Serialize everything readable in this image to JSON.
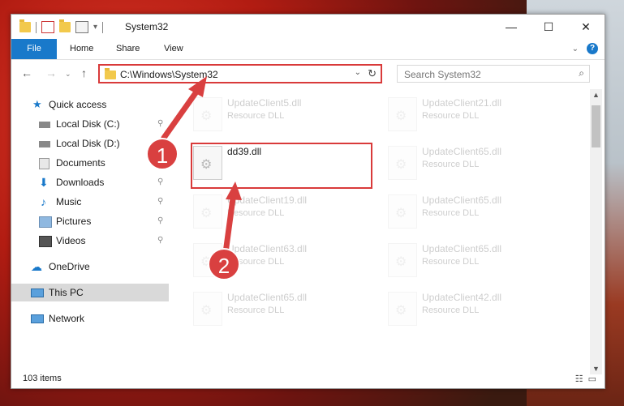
{
  "window": {
    "title": "System32",
    "buttons": {
      "minimize": "—",
      "maximize": "☐",
      "close": "✕"
    }
  },
  "ribbon": {
    "tabs": [
      "File",
      "Home",
      "Share",
      "View"
    ],
    "help": "?"
  },
  "address": {
    "path": "C:\\Windows\\System32"
  },
  "search": {
    "placeholder": "Search System32"
  },
  "sidebar": {
    "items": [
      {
        "label": "Quick access",
        "icon": "star-icon",
        "pinned": false
      },
      {
        "label": "Local Disk (C:)",
        "icon": "drive-icon",
        "pinned": true
      },
      {
        "label": "Local Disk (D:)",
        "icon": "drive-icon",
        "pinned": false
      },
      {
        "label": "Documents",
        "icon": "documents-icon",
        "pinned": true
      },
      {
        "label": "Downloads",
        "icon": "download-icon",
        "pinned": true
      },
      {
        "label": "Music",
        "icon": "music-icon",
        "pinned": true
      },
      {
        "label": "Pictures",
        "icon": "pictures-icon",
        "pinned": true
      },
      {
        "label": "Videos",
        "icon": "videos-icon",
        "pinned": true
      },
      {
        "label": "OneDrive",
        "icon": "cloud-icon",
        "pinned": false
      },
      {
        "label": "This PC",
        "icon": "computer-icon",
        "pinned": false,
        "selected": true
      },
      {
        "label": "Network",
        "icon": "network-icon",
        "pinned": false
      }
    ],
    "pin_glyph": "📌"
  },
  "files": {
    "left": [
      {
        "name": "UpdateClient5.dll",
        "desc": "Resource DLL"
      },
      {
        "name": "dd39.dll",
        "desc": ""
      },
      {
        "name": "UpdateClient19.dll",
        "desc": "Resource DLL"
      },
      {
        "name": "UpdateClient63.dll",
        "desc": "Resource DLL"
      },
      {
        "name": "UpdateClient65.dll",
        "desc": "Resource DLL"
      }
    ],
    "right": [
      {
        "name": "UpdateClient21.dll",
        "desc": "Resource DLL"
      },
      {
        "name": "UpdateClient65.dll",
        "desc": "Resource DLL"
      },
      {
        "name": "UpdateClient65.dll",
        "desc": "Resource DLL"
      },
      {
        "name": "UpdateClient65.dll",
        "desc": "Resource DLL"
      },
      {
        "name": "UpdateClient42.dll",
        "desc": "Resource DLL"
      }
    ]
  },
  "status": {
    "item_count": "103 items"
  },
  "callouts": {
    "one": "1",
    "two": "2"
  },
  "colors": {
    "accent": "#1979ca",
    "highlight": "#d93a3a",
    "selection": "#d9d9d9"
  }
}
